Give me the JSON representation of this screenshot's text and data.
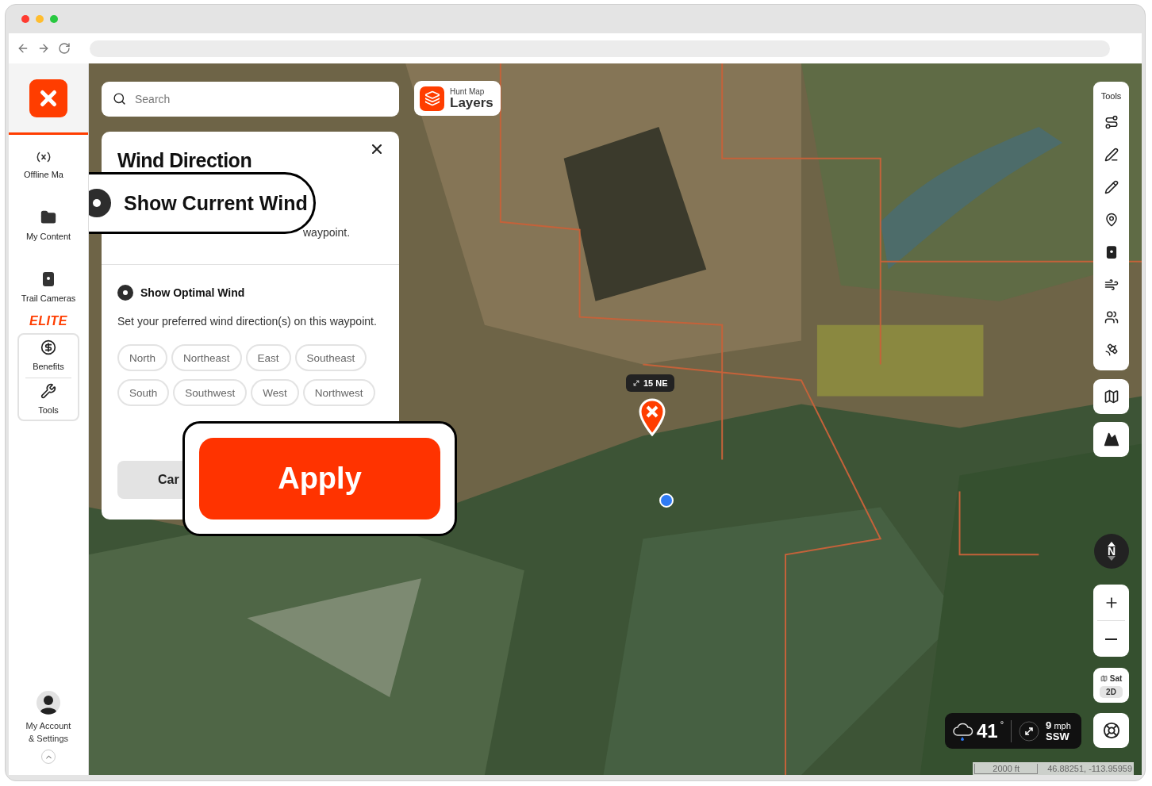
{
  "sidebar": {
    "items": [
      {
        "label": "Offline Ma",
        "kind": "offline"
      },
      {
        "label": "My Content",
        "kind": "content"
      },
      {
        "label": "Trail Cameras",
        "kind": "cameras"
      }
    ],
    "elite": {
      "badge": "ELITE",
      "items": [
        {
          "label": "Benefits",
          "kind": "benefits"
        },
        {
          "label": "Tools",
          "kind": "tools"
        }
      ]
    },
    "account": "My Account & Settings"
  },
  "search": {
    "placeholder": "Search"
  },
  "layers_button": {
    "caption": "Hunt Map",
    "label": "Layers"
  },
  "wind_panel": {
    "title": "Wind Direction",
    "current": {
      "label": "Show Current Wind",
      "checked": true,
      "description": "waypoint."
    },
    "optimal": {
      "label": "Show Optimal Wind",
      "checked": true,
      "description": "Set your preferred wind direction(s) on this waypoint."
    },
    "directions": [
      {
        "label": "North",
        "selected": false
      },
      {
        "label": "Northeast",
        "selected": false
      },
      {
        "label": "East",
        "selected": false
      },
      {
        "label": "Southeast",
        "selected": false
      },
      {
        "label": "South",
        "selected": false
      },
      {
        "label": "Southwest",
        "selected": false
      },
      {
        "label": "West",
        "selected": false
      },
      {
        "label": "Northwest",
        "selected": false
      }
    ],
    "cancel": "Car",
    "apply": "Apply"
  },
  "map": {
    "wind_badge": "15 NE",
    "tools": {
      "title": "Tools",
      "items": [
        {
          "kind": "route"
        },
        {
          "kind": "line"
        },
        {
          "kind": "shape"
        },
        {
          "kind": "pin"
        },
        {
          "kind": "camera"
        },
        {
          "kind": "wind"
        },
        {
          "kind": "people"
        },
        {
          "kind": "satellite"
        }
      ]
    },
    "buttons": [
      {
        "kind": "hide"
      },
      {
        "kind": "terrain"
      }
    ],
    "compass": "N",
    "map_style": [
      {
        "label": "Sat",
        "selected": false
      },
      {
        "label": "2D",
        "selected": true
      }
    ],
    "weather": {
      "temperature": "41",
      "degree": "°",
      "wind_speed": "9",
      "wind_unit": "mph",
      "wind_direction": "SSW"
    },
    "scale": "2000 ft",
    "coordinates": "46.88251, -113.95959"
  }
}
